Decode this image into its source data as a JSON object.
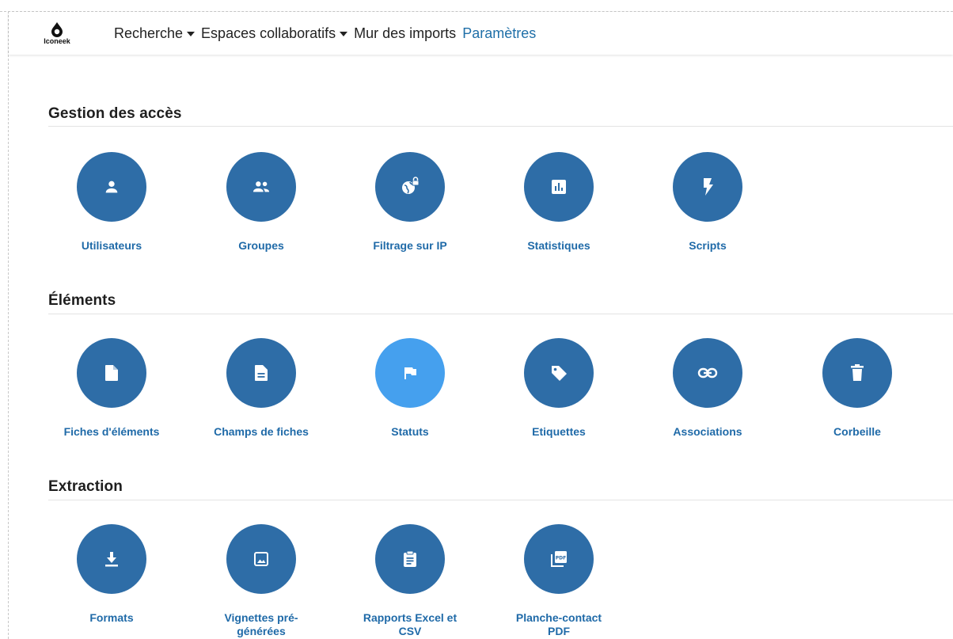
{
  "brand": {
    "name": "Iconeek"
  },
  "nav": {
    "items": [
      {
        "label": "Recherche",
        "dropdown": true,
        "active": false
      },
      {
        "label": "Espaces collaboratifs",
        "dropdown": true,
        "active": false
      },
      {
        "label": "Mur des imports",
        "dropdown": false,
        "active": false
      },
      {
        "label": "Paramètres",
        "dropdown": false,
        "active": true
      }
    ]
  },
  "colors": {
    "accent": "#2e6da7",
    "highlight": "#45a0ee",
    "label": "#1f6aa8"
  },
  "sections": [
    {
      "title": "Gestion des accès",
      "items": [
        {
          "label": "Utilisateurs",
          "icon": "user-icon"
        },
        {
          "label": "Groupes",
          "icon": "group-icon"
        },
        {
          "label": "Filtrage sur IP",
          "icon": "globe-lock-icon"
        },
        {
          "label": "Statistiques",
          "icon": "bar-chart-icon"
        },
        {
          "label": "Scripts",
          "icon": "bolt-icon"
        }
      ]
    },
    {
      "title": "Éléments",
      "items": [
        {
          "label": "Fiches d'éléments",
          "icon": "file-icon"
        },
        {
          "label": "Champs de fiches",
          "icon": "file-text-icon"
        },
        {
          "label": "Statuts",
          "icon": "flag-icon",
          "highlighted": true
        },
        {
          "label": "Etiquettes",
          "icon": "tag-icon"
        },
        {
          "label": "Associations",
          "icon": "link-icon"
        },
        {
          "label": "Corbeille",
          "icon": "trash-icon"
        }
      ]
    },
    {
      "title": "Extraction",
      "items": [
        {
          "label": "Formats",
          "icon": "download-icon"
        },
        {
          "label": "Vignettes pré-générées",
          "icon": "image-icon"
        },
        {
          "label": "Rapports Excel et CSV",
          "icon": "clipboard-icon"
        },
        {
          "label": "Planche-contact PDF",
          "icon": "pdf-icon"
        }
      ]
    }
  ]
}
